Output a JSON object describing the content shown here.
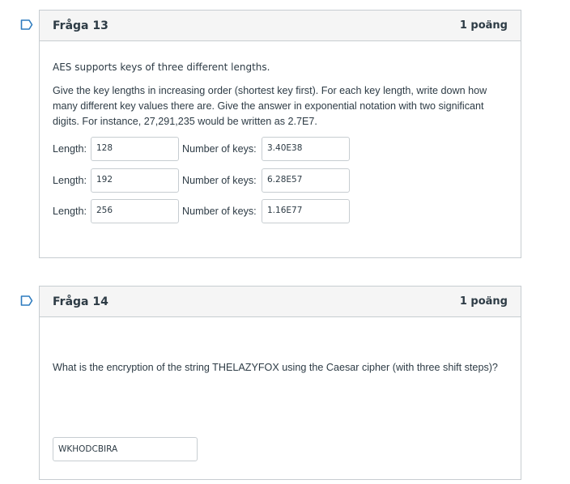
{
  "questions": [
    {
      "title": "Fråga 13",
      "points": "1 poäng",
      "intro": "AES supports keys of three different lengths.",
      "instructions": "Give the key lengths in increasing order (shortest key first). For each key length, write down how many different key values there are. Give the answer in exponential notation with two significant digits. For instance, 27,291,235 would be written as 2.7E7.",
      "rows": [
        {
          "length_label": "Length:",
          "length_value": "128",
          "keys_label": "Number of keys:",
          "keys_value": "3.40E38"
        },
        {
          "length_label": "Length:",
          "length_value": "192",
          "keys_label": "Number of keys:",
          "keys_value": "6.28E57"
        },
        {
          "length_label": "Length:",
          "length_value": "256",
          "keys_label": "Number of keys:",
          "keys_value": "1.16E77"
        }
      ]
    },
    {
      "title": "Fråga 14",
      "points": "1 poäng",
      "text": "What is the encryption of the string THELAZYFOX using the Caesar cipher (with three shift steps)?",
      "answer": "WKHODCBIRA"
    }
  ],
  "colors": {
    "flag": "#2d7bbf",
    "text": "#2d3b45",
    "border": "#c7cdd1",
    "header_bg": "#f5f5f5"
  },
  "icons": {
    "flag": "bookmark-flag-icon"
  }
}
